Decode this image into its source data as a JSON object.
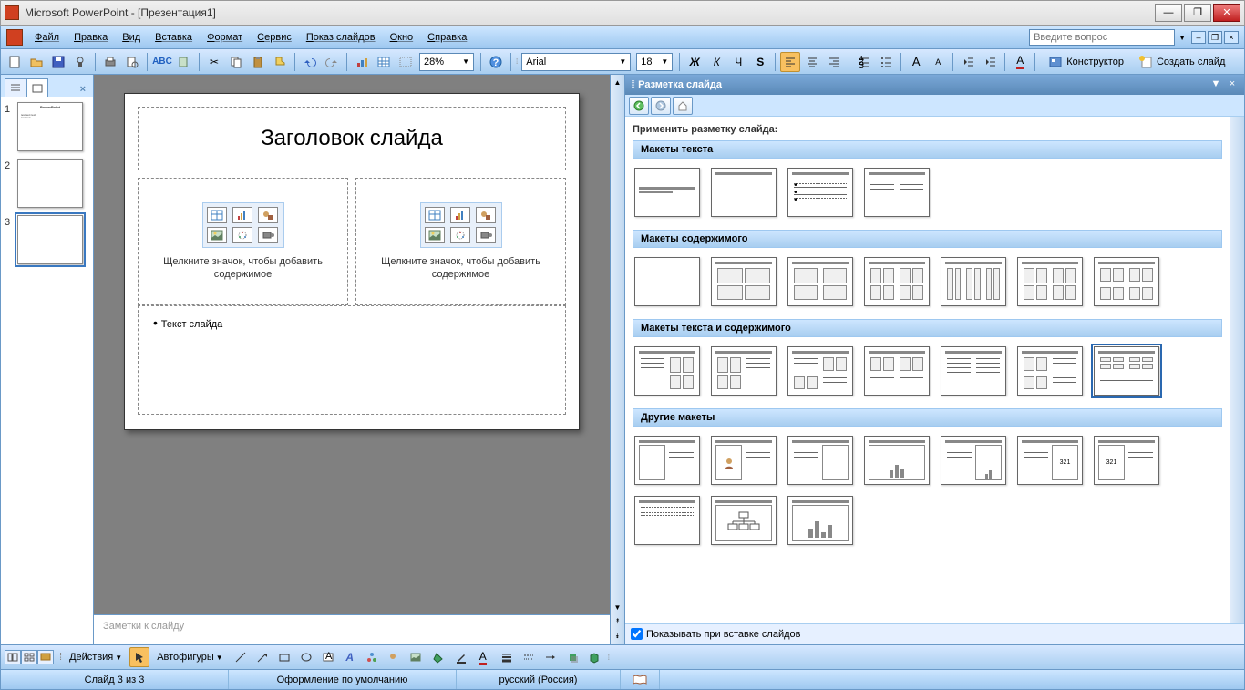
{
  "window": {
    "title": "Microsoft PowerPoint - [Презентация1]"
  },
  "menu": {
    "items": [
      "Файл",
      "Правка",
      "Вид",
      "Вставка",
      "Формат",
      "Сервис",
      "Показ слайдов",
      "Окно",
      "Справка"
    ],
    "help_placeholder": "Введите вопрос"
  },
  "toolbar": {
    "zoom": "28%",
    "font_name": "Arial",
    "font_size": "18",
    "designer": "Конструктор",
    "new_slide": "Создать слайд"
  },
  "thumbs": {
    "count": 3,
    "selected": 3
  },
  "slide": {
    "title": "Заголовок слайда",
    "content_hint": "Щелкните значок, чтобы добавить содержимое",
    "text_bullet": "Текст слайда"
  },
  "notes": {
    "placeholder": "Заметки к слайду"
  },
  "taskpane": {
    "title": "Разметка слайда",
    "apply": "Применить разметку слайда:",
    "cat_text": "Макеты текста",
    "cat_content": "Макеты содержимого",
    "cat_textcontent": "Макеты текста и содержимого",
    "cat_other": "Другие макеты",
    "show_on_insert": "Показывать при вставке слайдов"
  },
  "drawbar": {
    "actions": "Действия",
    "autoshapes": "Автофигуры"
  },
  "status": {
    "slide": "Слайд 3 из 3",
    "design": "Оформление по умолчанию",
    "lang": "русский (Россия)"
  }
}
